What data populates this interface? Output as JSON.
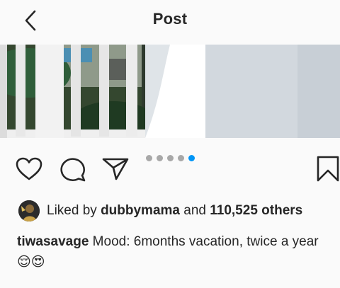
{
  "header": {
    "title": "Post",
    "back_icon": "chevron-left-icon"
  },
  "post": {
    "carousel": {
      "count": 5,
      "active_index": 4
    },
    "likes": {
      "prefix": "Liked by",
      "first_liker": "dubbymama",
      "joiner": "and",
      "others": "110,525 others"
    },
    "caption": {
      "username": "tiwasavage",
      "text": " Mood: 6months vacation, twice a year ",
      "emojis": "😌😍"
    }
  },
  "colors": {
    "accent": "#0095f6",
    "dot_inactive": "#a8a8a8",
    "text": "#262626"
  },
  "icons": [
    "heart-icon",
    "comment-icon",
    "share-icon",
    "bookmark-icon"
  ]
}
